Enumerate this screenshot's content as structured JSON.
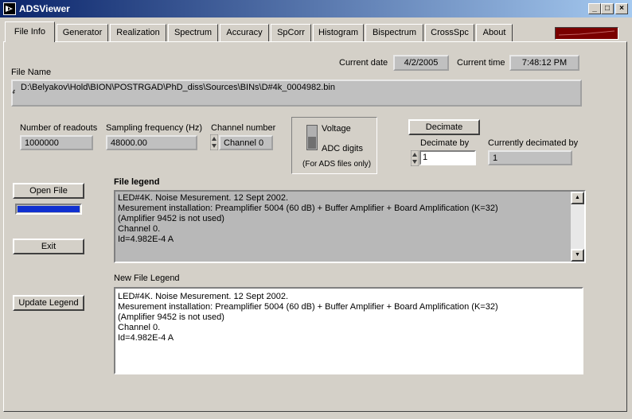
{
  "window": {
    "title": "ADSViewer",
    "min": "_",
    "max": "□",
    "close": "×"
  },
  "tabs": [
    {
      "label": "File Info"
    },
    {
      "label": "Generator"
    },
    {
      "label": "Realization"
    },
    {
      "label": "Spectrum"
    },
    {
      "label": "Accuracy"
    },
    {
      "label": "SpCorr"
    },
    {
      "label": "Histogram"
    },
    {
      "label": "Bispectrum"
    },
    {
      "label": "CrossSpc"
    },
    {
      "label": "About"
    }
  ],
  "colors": {
    "accent_red": "#7a0000",
    "progress": "#1030d0"
  },
  "header": {
    "current_date_label": "Current date",
    "current_date": "4/2/2005",
    "current_time_label": "Current time",
    "current_time": "7:48:12 PM"
  },
  "file": {
    "name_label": "File Name",
    "path": "D:\\Belyakov\\Hold\\BION\\POSTRGAD\\PhD_diss\\Sources\\BINs\\D#4k_0004982.bin",
    "path_icon_glyph": "ᵳ"
  },
  "readouts": {
    "number_label": "Number of readouts",
    "number": "1000000",
    "freq_label": "Sampling frequency (Hz)",
    "freq": "48000.00",
    "channel_label": "Channel number",
    "channel": "Channel  0"
  },
  "switch": {
    "voltage": "Voltage",
    "adc": "ADC digits",
    "note": "(For ADS files only)"
  },
  "decimate": {
    "button": "Decimate",
    "by_label": "Decimate by",
    "by_value": "1",
    "current_label": "Currently decimated by",
    "current_value": "1"
  },
  "buttons": {
    "open_file": "Open File",
    "exit": "Exit",
    "update_legend": "Update Legend"
  },
  "progress": 1.0,
  "legend": {
    "title": "File legend",
    "text": "LED#4K. Noise Mesurement. 12 Sept 2002.\nMesurement installation: Preamplifier 5004 (60 dB) + Buffer Amplifier + Board Amplification (K=32)\n(Amplifier 9452 is not used)\nChannel 0.\nId=4.982E-4 A"
  },
  "new_legend": {
    "title": "New File Legend",
    "text": "LED#4K. Noise Mesurement. 12 Sept 2002.\nMesurement installation: Preamplifier 5004 (60 dB) + Buffer Amplifier + Board Amplification (K=32)\n(Amplifier 9452 is not used)\nChannel 0.\nId=4.982E-4 A"
  },
  "scroll": {
    "up": "▲",
    "down": "▼"
  }
}
